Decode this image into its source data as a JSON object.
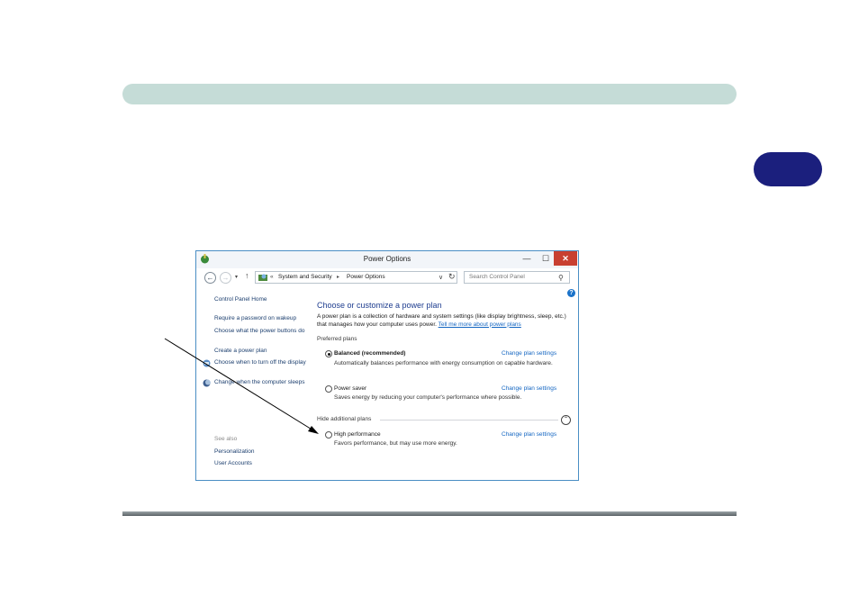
{
  "window": {
    "title": "Power Options",
    "min_glyph": "—",
    "max_glyph": "☐",
    "close_glyph": "✕"
  },
  "nav": {
    "back_glyph": "←",
    "forward_glyph": "→",
    "recent_glyph": "▾",
    "up_glyph": "↑",
    "address_overflow": "«",
    "address_segment_1": "System and Security",
    "address_separator": "▸",
    "address_segment_2": "Power Options",
    "dropdown_glyph": "∨",
    "refresh_glyph": "↻",
    "search_placeholder": "Search Control Panel",
    "search_glyph": "⚲"
  },
  "help_glyph": "?",
  "sidebar": {
    "home": "Control Panel Home",
    "links": [
      "Require a password on wakeup",
      "Choose what the power buttons do",
      "Create a power plan",
      "Choose when to turn off the display",
      "Change when the computer sleeps"
    ],
    "see_also_label": "See also",
    "see_also_links": [
      "Personalization",
      "User Accounts"
    ]
  },
  "main": {
    "title": "Choose or customize a power plan",
    "description": "A power plan is a collection of hardware and system settings (like display brightness, sleep, etc.) that manages how your computer uses power.",
    "description_link": "Tell me more about power plans",
    "preferred_label": "Preferred plans",
    "hide_label": "Hide additional plans",
    "collapse_glyph": "⌃",
    "plans": [
      {
        "name": "Balanced (recommended)",
        "description": "Automatically balances performance with energy consumption on capable hardware.",
        "link": "Change plan settings",
        "selected": true
      },
      {
        "name": "Power saver",
        "description": "Saves energy by reducing your computer's performance where possible.",
        "link": "Change plan settings",
        "selected": false
      },
      {
        "name": "High performance",
        "description": "Favors performance, but may use more energy.",
        "link": "Change plan settings",
        "selected": false
      }
    ]
  },
  "colors": {
    "top_bar": "#c5dcd7",
    "chapter_tab": "#1b1f7d",
    "link": "#1466c2",
    "title_blue": "#1e3d8f",
    "close_button": "#c84031"
  }
}
